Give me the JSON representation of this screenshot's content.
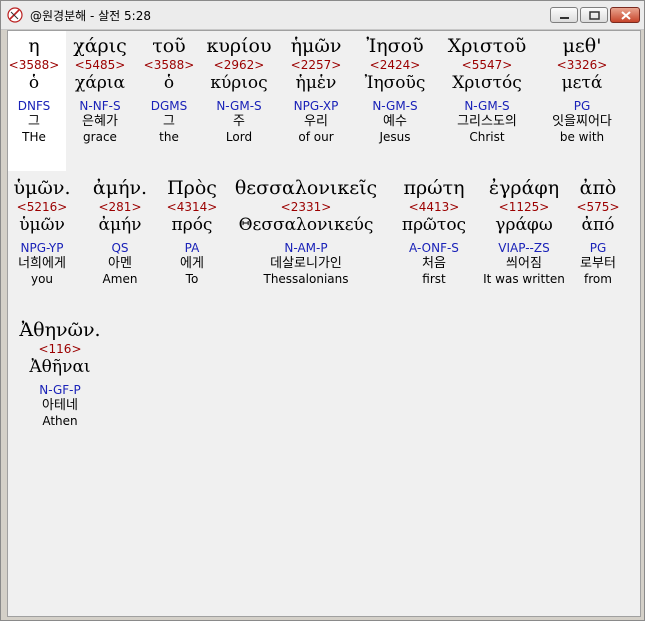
{
  "window": {
    "title": "@원경분해 - 살전 5:28",
    "controls": {
      "minimize": "minimize",
      "maximize": "maximize",
      "close": "close"
    }
  },
  "colors": {
    "strong": "#9b0000",
    "parse": "#1a22b8",
    "highlight": "#ffffff"
  },
  "rows": [
    {
      "words": [
        {
          "greek": "η",
          "strong": "<3588>",
          "lemma": "ὁ",
          "parse": "DNFS",
          "kor": "그",
          "eng": "THe"
        },
        {
          "greek": "χάρις",
          "strong": "<5485>",
          "lemma": "χάρια",
          "parse": "N-NF-S",
          "kor": "은혜가",
          "eng": "grace"
        },
        {
          "greek": "τοῦ",
          "strong": "<3588>",
          "lemma": "ὁ",
          "parse": "DGMS",
          "kor": "그",
          "eng": "the"
        },
        {
          "greek": "κυρίου",
          "strong": "<2962>",
          "lemma": "κύριος",
          "parse": "N-GM-S",
          "kor": "주",
          "eng": "Lord"
        },
        {
          "greek": "ἡμῶν",
          "strong": "<2257>",
          "lemma": "ἡμἑν",
          "parse": "NPG-XP",
          "kor": "우리",
          "eng": "of our"
        },
        {
          "greek": "Ἰησοῦ",
          "strong": "<2424>",
          "lemma": "Ἰησοῦς",
          "parse": "N-GM-S",
          "kor": "예수",
          "eng": "Jesus"
        },
        {
          "greek": "Χριστοῦ",
          "strong": "<5547>",
          "lemma": "Χριστός",
          "parse": "N-GM-S",
          "kor": "그리스도의",
          "eng": "Christ"
        },
        {
          "greek": "μεθ'",
          "strong": "<3326>",
          "lemma": "μετά",
          "parse": "PG",
          "kor": "잇을찌어다",
          "eng": "be with"
        }
      ]
    },
    {
      "words": [
        {
          "greek": "ὑμῶν.",
          "strong": "<5216>",
          "lemma": "ὑμῶν",
          "parse": "NPG-YP",
          "kor": "너희에게",
          "eng": "you"
        },
        {
          "greek": "ἀμήν.",
          "strong": "<281>",
          "lemma": "ἀμήν",
          "parse": "QS",
          "kor": "아멘",
          "eng": "Amen"
        },
        {
          "greek": "Πρὸς",
          "strong": "<4314>",
          "lemma": "πρός",
          "parse": "PA",
          "kor": "에게",
          "eng": "To"
        },
        {
          "greek": "θεσσαλονικεῖς",
          "strong": "<2331>",
          "lemma": "Θεσσαλονικεύς",
          "parse": "N-AM-P",
          "kor": "데살로니가인",
          "eng": "Thessalonians"
        },
        {
          "greek": "πρώτη",
          "strong": "<4413>",
          "lemma": "πρῶτος",
          "parse": "A-ONF-S",
          "kor": "처음",
          "eng": "first"
        },
        {
          "greek": "ἐγράφη",
          "strong": "<1125>",
          "lemma": "γράφω",
          "parse": "VIAP--ZS",
          "kor": "씌어짐",
          "eng": "It was written"
        },
        {
          "greek": "ἀπὸ",
          "strong": "<575>",
          "lemma": "ἀπό",
          "parse": "PG",
          "kor": "로부터",
          "eng": "from"
        }
      ]
    },
    {
      "words": [
        {
          "greek": "Ἀθηνῶν.",
          "strong": "<116>",
          "lemma": "Ἀθῆναι",
          "parse": "N-GF-P",
          "kor": "아테네",
          "eng": "Athen"
        }
      ]
    }
  ]
}
